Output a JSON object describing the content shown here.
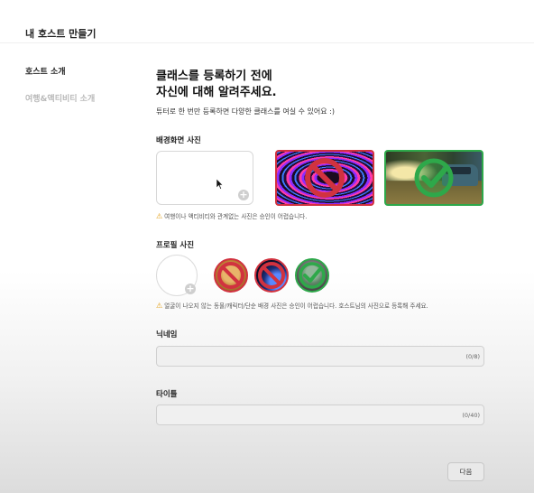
{
  "page": {
    "title": "내 호스트 만들기"
  },
  "sidebar": {
    "items": [
      {
        "label": "호스트 소개",
        "active": true
      },
      {
        "label": "여행&액티비티 소개",
        "active": false
      }
    ]
  },
  "intro": {
    "headline_line1": "클래스를 등록하기 전에",
    "headline_line2": "자신에 대해 알려주세요.",
    "subtitle": "튜터로 한 번만 등록하면 다양한 클래스를 여실 수 있어요 :)"
  },
  "background_photo": {
    "label": "배경화면 사진",
    "notice": "여행이나 액티비티와 관계없는 사진은 승인이 어렵습니다.",
    "examples": [
      {
        "kind": "rejected",
        "icon": "prohibited-icon"
      },
      {
        "kind": "approved",
        "icon": "check-icon"
      }
    ]
  },
  "profile_photo": {
    "label": "프로필 사진",
    "notice": "얼굴이 나오지 않는 동물/캐릭터/단순 배경 사진은 승인이 어렵습니다. 호스트님의 사진으로 등록해 주세요.",
    "examples": [
      {
        "kind": "rejected",
        "icon": "prohibited-icon"
      },
      {
        "kind": "rejected",
        "icon": "prohibited-icon"
      },
      {
        "kind": "approved",
        "icon": "check-icon"
      }
    ]
  },
  "nickname": {
    "label": "닉네임",
    "value": "",
    "counter": "(0/8)"
  },
  "title_field": {
    "label": "타이틀",
    "value": "",
    "counter": "(0/40)"
  },
  "next_button": {
    "label": "다음"
  },
  "colors": {
    "rejected": "#d1323f",
    "approved": "#2ea84a",
    "warning": "#e2a019"
  }
}
